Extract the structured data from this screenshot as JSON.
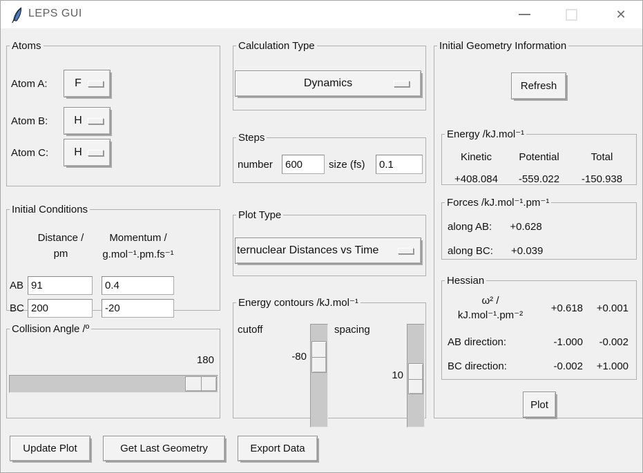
{
  "colors": {
    "content_bg": "#f0f0f0",
    "titlebar_bg": "#ffffff",
    "title_text": "#5f5f5f",
    "feather_blue": "#4e7ab5"
  },
  "titlebar": {
    "title": "LEPS GUI",
    "icons": {
      "app": "feather-icon",
      "minimize_glyph": "—",
      "close_glyph": "✕"
    }
  },
  "atoms": {
    "legend": "Atoms",
    "items": [
      {
        "label": "Atom A:",
        "value": "F"
      },
      {
        "label": "Atom B:",
        "value": "H"
      },
      {
        "label": "Atom C:",
        "value": "H"
      }
    ]
  },
  "initial_conditions": {
    "legend": "Initial Conditions",
    "col_distance_line1": "Distance /",
    "col_distance_line2": "pm",
    "col_momentum_line1": "Momentum /",
    "col_momentum_line2": "g.mol⁻¹.pm.fs⁻¹",
    "rows": [
      {
        "label": "AB",
        "distance": "91",
        "momentum": "0.4"
      },
      {
        "label": "BC",
        "distance": "200",
        "momentum": "-20"
      }
    ]
  },
  "collision_angle": {
    "legend": "Collision Angle /º",
    "value": "180"
  },
  "calculation_type": {
    "legend": "Calculation Type",
    "value": "Dynamics"
  },
  "steps": {
    "legend": "Steps",
    "number_label": "number",
    "number_value": "600",
    "size_label": "size (fs)",
    "size_value": "0.1"
  },
  "plot_type": {
    "legend": "Plot Type",
    "value": "ternuclear Distances vs Time"
  },
  "energy_contours": {
    "legend": "Energy contours /kJ.mol⁻¹",
    "cutoff_label": "cutoff",
    "cutoff_value": "-80",
    "spacing_label": "spacing",
    "spacing_value": "10"
  },
  "geometry_info": {
    "legend": "Initial Geometry Information",
    "refresh_label": "Refresh",
    "plot_label": "Plot",
    "energy": {
      "legend": "Energy /kJ.mol⁻¹",
      "headers": [
        "Kinetic",
        "Potential",
        "Total"
      ],
      "values": [
        "+408.084",
        "-559.022",
        "-150.938"
      ]
    },
    "forces": {
      "legend": "Forces /kJ.mol⁻¹.pm⁻¹",
      "rows": [
        {
          "label": "along AB:",
          "value": "+0.628"
        },
        {
          "label": "along BC:",
          "value": "+0.039"
        }
      ]
    },
    "hessian": {
      "legend": "Hessian",
      "matrix_label_line1": "ω² /",
      "matrix_label_line2": "kJ.mol⁻¹.pm⁻²",
      "rows": [
        {
          "label": "",
          "v1": "+0.618",
          "v2": "+0.001"
        },
        {
          "label": "AB direction:",
          "v1": "-1.000",
          "v2": "-0.002"
        },
        {
          "label": "BC direction:",
          "v1": "-0.002",
          "v2": "+1.000"
        }
      ]
    }
  },
  "footer": {
    "buttons": [
      "Update Plot",
      "Get Last Geometry",
      "Export Data"
    ]
  }
}
